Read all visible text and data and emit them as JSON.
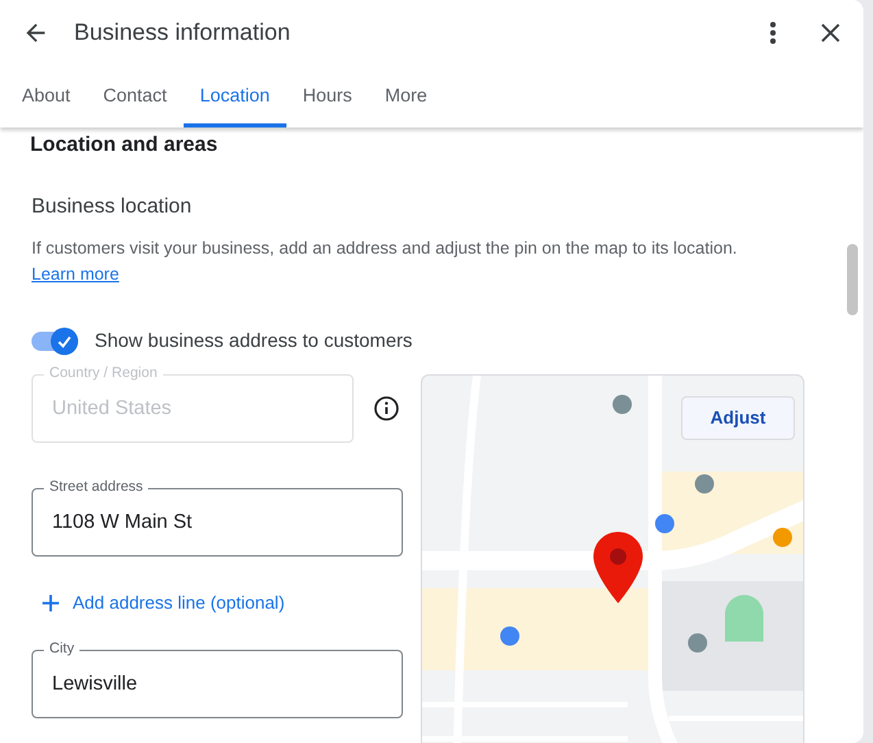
{
  "header": {
    "title": "Business information"
  },
  "tabs": [
    {
      "label": "About",
      "selected": false
    },
    {
      "label": "Contact",
      "selected": false
    },
    {
      "label": "Location",
      "selected": true
    },
    {
      "label": "Hours",
      "selected": false
    },
    {
      "label": "More",
      "selected": false
    }
  ],
  "section_heading": "Location and areas",
  "business_location": {
    "title": "Business location",
    "description": "If customers visit your business, add an address and adjust the pin on the map to its location.",
    "link": "Learn more"
  },
  "toggle": {
    "label": "Show business address to customers",
    "on": true
  },
  "form_items": [
    {
      "kind": "field",
      "label": "Country / Region",
      "value": "United States",
      "disabled": true,
      "info": true
    },
    {
      "kind": "field",
      "label": "Street address",
      "value": "1108 W Main St",
      "disabled": false,
      "info": false
    },
    {
      "kind": "add_button",
      "label": "Add address line (optional)"
    },
    {
      "kind": "field",
      "label": "City",
      "value": "Lewisville",
      "disabled": false,
      "info": false
    }
  ],
  "map": {
    "button": "Adjust"
  }
}
